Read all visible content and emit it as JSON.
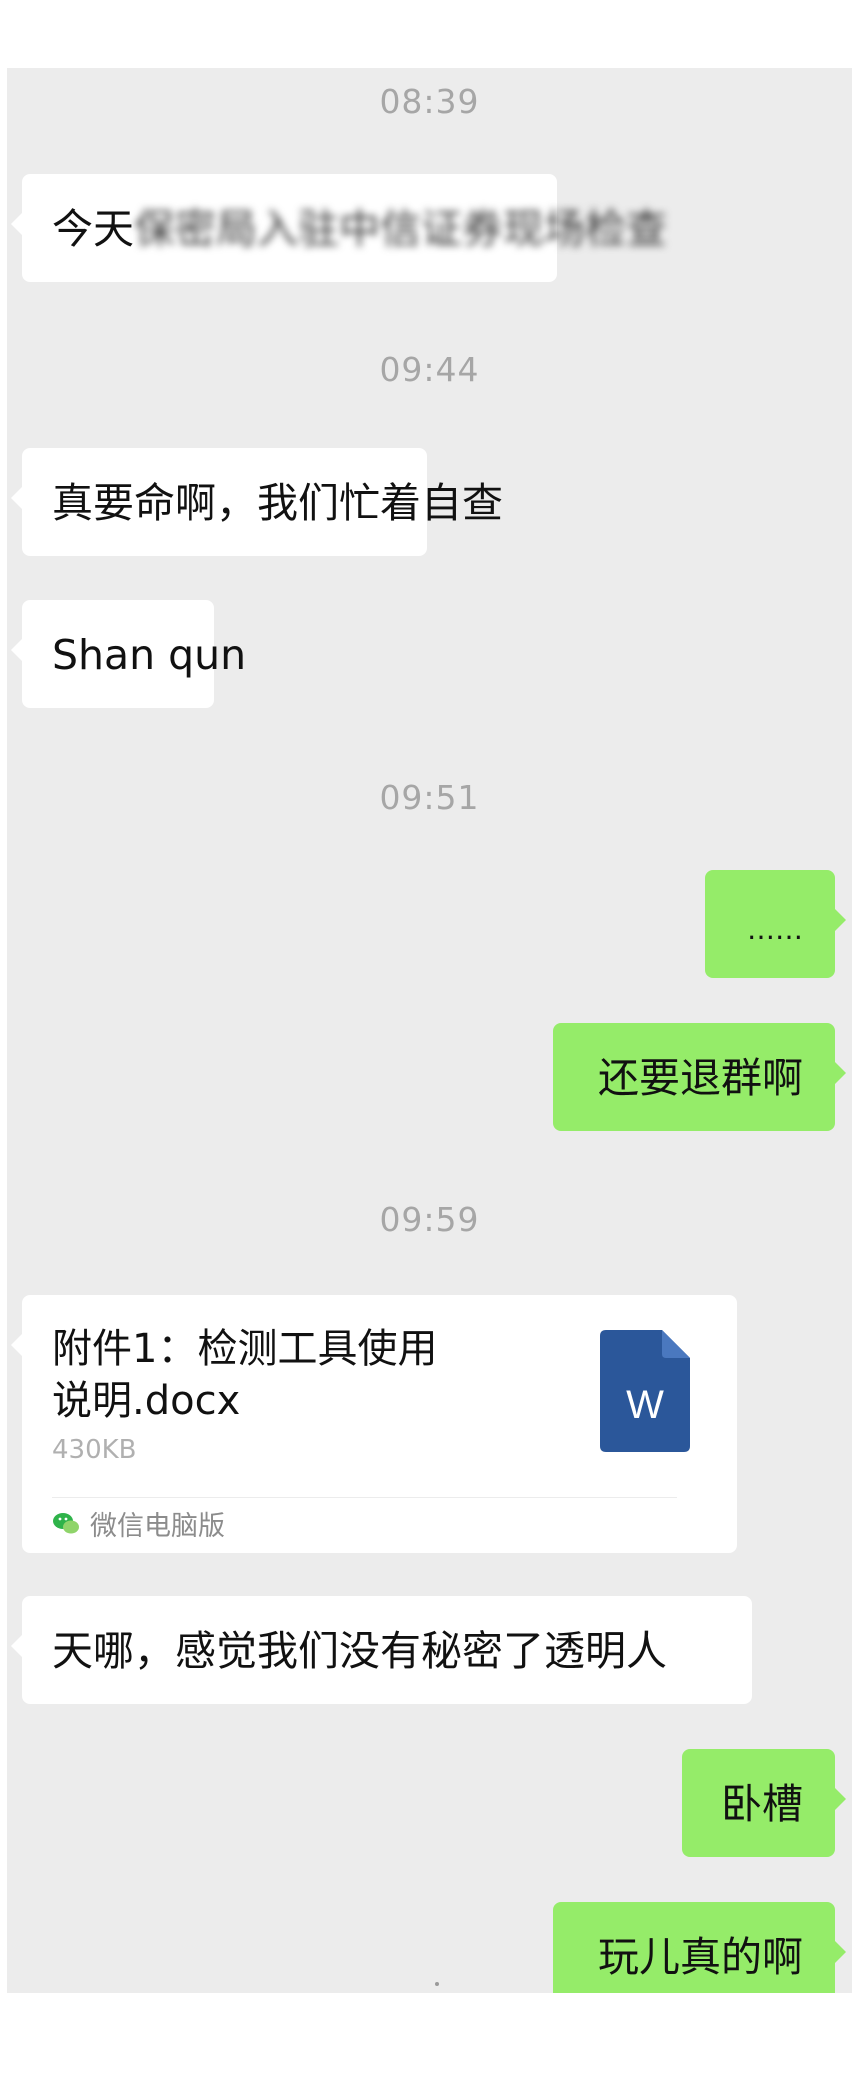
{
  "timestamps": {
    "t1": "08:39",
    "t2": "09:44",
    "t3": "09:51",
    "t4": "09:59"
  },
  "messages": {
    "m1_visible": "今天",
    "m1_blurred": "保密局入驻中信证券现场检查",
    "m2": "真要命啊，我们忙着自查",
    "m3": "Shan  qun",
    "m4": "……",
    "m5": "还要退群啊",
    "m6": "天哪，感觉我们没有秘密了透明人",
    "m7": "卧槽",
    "m8": "玩儿真的啊"
  },
  "file": {
    "name": "附件1：检测工具使用说明.docx",
    "size": "430KB",
    "icon_letter": "W",
    "icon": "word-document-icon",
    "source": "微信电脑版",
    "source_icon": "wechat-icon"
  },
  "colors": {
    "chat_bg": "#ececec",
    "incoming_bubble": "#ffffff",
    "outgoing_bubble": "#95ec69",
    "timestamp_text": "#a6a6a6",
    "word_icon": "#2b579a"
  }
}
